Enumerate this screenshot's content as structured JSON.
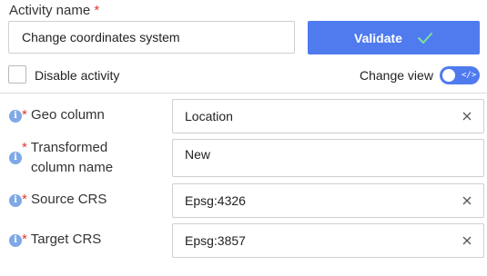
{
  "activity": {
    "label": "Activity name",
    "required_mark": "*",
    "value": "Change coordinates system"
  },
  "validate": {
    "label": "Validate",
    "color": "#4f7bef"
  },
  "disable_activity": {
    "label": "Disable activity",
    "checked": false
  },
  "change_view": {
    "label": "Change view",
    "toggle_on": true,
    "toggle_glyph": "</>"
  },
  "fields": [
    {
      "label": "Geo column",
      "value": "Location",
      "has_info": true,
      "required": true,
      "clearable": true
    },
    {
      "label_line1": "Transformed",
      "label_line2": "column name",
      "value": "New",
      "has_info": true,
      "required": true,
      "clearable": false
    },
    {
      "label": "Source CRS",
      "value": "Epsg:4326",
      "has_info": true,
      "required": true,
      "clearable": true
    },
    {
      "label": "Target CRS",
      "value": "Epsg:3857",
      "has_info": true,
      "required": true,
      "clearable": true
    }
  ],
  "icons": {
    "info": "i",
    "required": "*"
  }
}
